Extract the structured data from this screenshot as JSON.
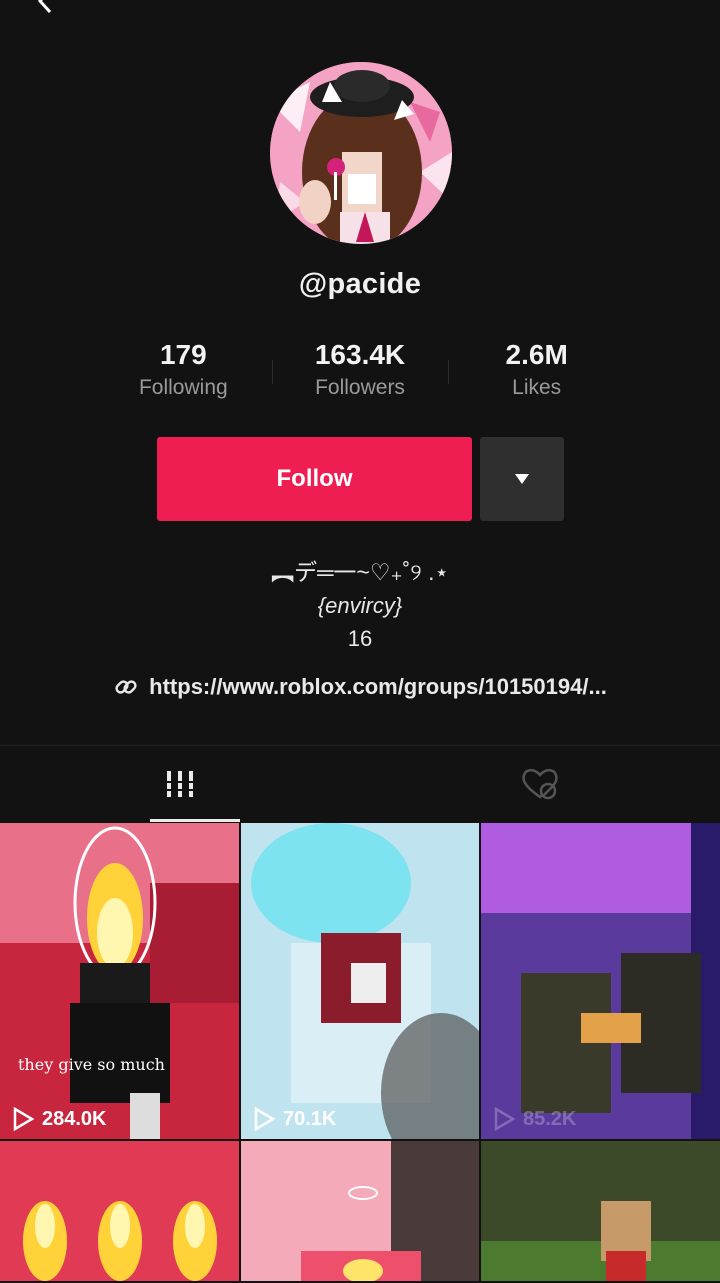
{
  "profile": {
    "username": "@pacide",
    "stats": [
      {
        "value": "179",
        "label": "Following"
      },
      {
        "value": "163.4K",
        "label": "Followers"
      },
      {
        "value": "2.6M",
        "label": "Likes"
      }
    ],
    "follow_label": "Follow",
    "bio": {
      "line1": "︻デ═一~♡₊˚୨ .⋆",
      "line2": "{envircy}",
      "line3": "16"
    },
    "link": "https://www.roblox.com/groups/10150194/..."
  },
  "tabs": [
    {
      "name": "videos",
      "icon": "grid-icon",
      "active": true
    },
    {
      "name": "liked",
      "icon": "liked-hidden-icon",
      "active": false
    }
  ],
  "videos": [
    {
      "views": "284.0K",
      "caption": "they give so much",
      "color": "#c8253f"
    },
    {
      "views": "70.1K",
      "caption": "",
      "color": "#bfe4f0"
    },
    {
      "views": "85.2K",
      "caption": "",
      "color": "#6b44b8"
    },
    {
      "views": "",
      "caption": "",
      "color": "#e03a55"
    },
    {
      "views": "",
      "caption": "",
      "color": "#f4aab8"
    },
    {
      "views": "",
      "caption": "",
      "color": "#3d4a2a"
    }
  ],
  "colors": {
    "accent": "#ee1d52",
    "background": "#121212"
  }
}
